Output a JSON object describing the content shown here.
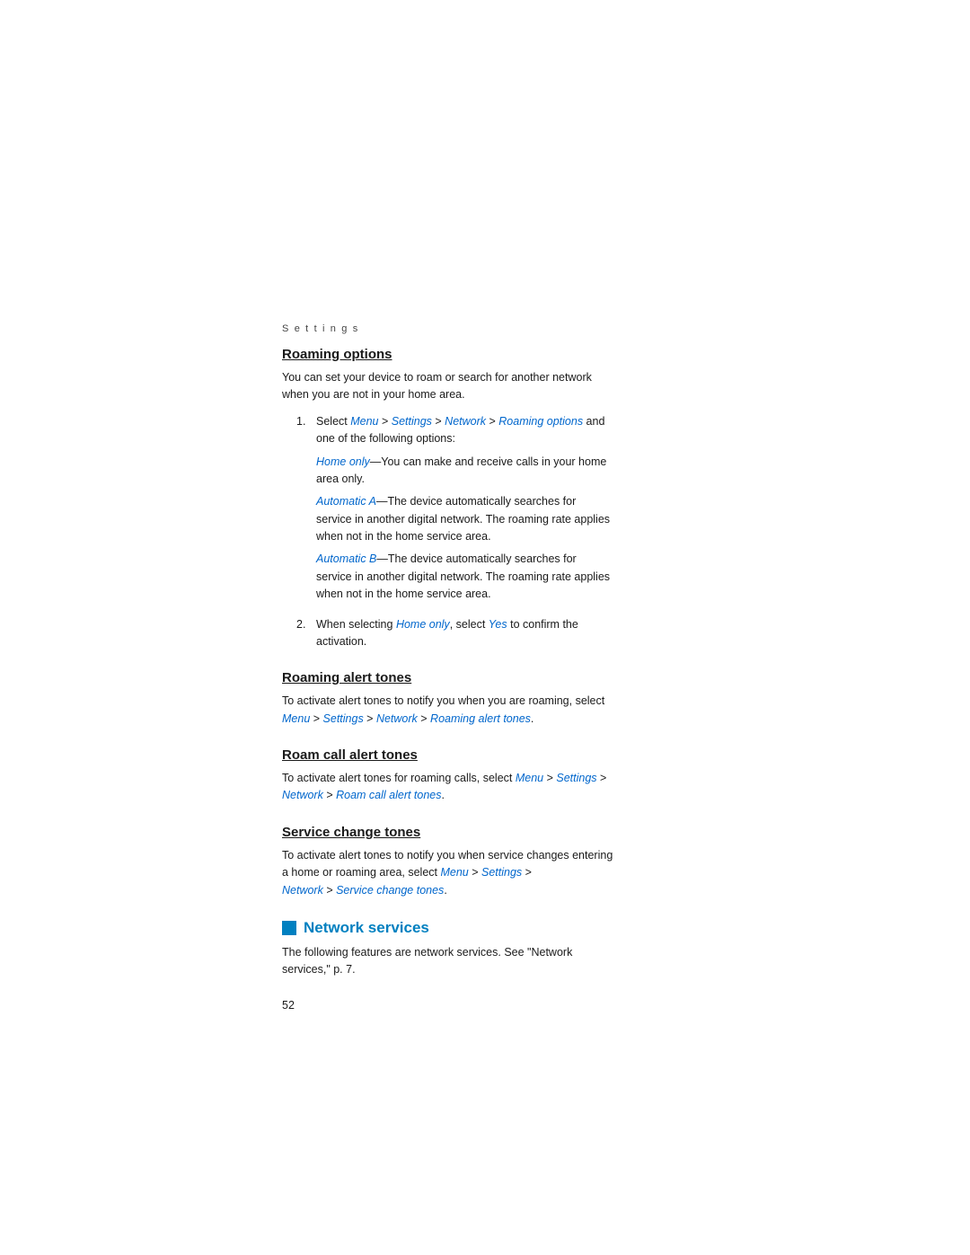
{
  "page": {
    "number": "52"
  },
  "breadcrumb": "S e t t i n g s",
  "sections": [
    {
      "id": "roaming-options",
      "title": "Roaming options",
      "style": "underline",
      "intro": "You can set your device to roam or search for another network when you are not in your home area.",
      "numbered_items": [
        {
          "num": "1.",
          "text_parts": [
            {
              "type": "text",
              "value": "Select "
            },
            {
              "type": "link",
              "value": "Menu"
            },
            {
              "type": "text",
              "value": " > "
            },
            {
              "type": "link",
              "value": "Settings"
            },
            {
              "type": "text",
              "value": " > "
            },
            {
              "type": "link",
              "value": "Network"
            },
            {
              "type": "text",
              "value": " > "
            },
            {
              "type": "link",
              "value": "Roaming options"
            },
            {
              "type": "text",
              "value": " and one of the following options:"
            }
          ],
          "options": [
            {
              "label": "Home only",
              "desc": "—You can make and receive calls in your home area only."
            },
            {
              "label": "Automatic A",
              "desc": "—The device automatically searches for service in another digital network. The roaming rate applies when not in the home service area."
            },
            {
              "label": "Automatic B",
              "desc": "—The device automatically searches for service in another digital network. The roaming rate applies when not in the home service area."
            }
          ]
        },
        {
          "num": "2.",
          "text_parts": [
            {
              "type": "text",
              "value": "When selecting "
            },
            {
              "type": "link",
              "value": "Home only"
            },
            {
              "type": "text",
              "value": ", select "
            },
            {
              "type": "link",
              "value": "Yes"
            },
            {
              "type": "text",
              "value": " to confirm the activation."
            }
          ],
          "options": []
        }
      ]
    },
    {
      "id": "roaming-alert-tones",
      "title": "Roaming alert tones",
      "style": "underline",
      "body": "To activate alert tones to notify you when you are roaming, select ",
      "body_links": [
        {
          "type": "link",
          "value": "Menu"
        },
        {
          "type": "text",
          "value": " > "
        },
        {
          "type": "link",
          "value": "Settings"
        },
        {
          "type": "text",
          "value": " > "
        },
        {
          "type": "link",
          "value": "Network"
        },
        {
          "type": "text",
          "value": " > "
        },
        {
          "type": "link",
          "value": "Roaming alert tones"
        },
        {
          "type": "text",
          "value": "."
        }
      ]
    },
    {
      "id": "roam-call-alert-tones",
      "title": "Roam call alert tones",
      "style": "underline",
      "body": "To activate alert tones for roaming calls, select ",
      "body_links": [
        {
          "type": "link",
          "value": "Menu"
        },
        {
          "type": "text",
          "value": " > "
        },
        {
          "type": "link",
          "value": "Settings"
        },
        {
          "type": "text",
          "value": " > "
        },
        {
          "type": "link",
          "value": "Network"
        },
        {
          "type": "text",
          "value": " > "
        },
        {
          "type": "link",
          "value": "Roam call alert tones"
        },
        {
          "type": "text",
          "value": "."
        }
      ]
    },
    {
      "id": "service-change-tones",
      "title": "Service change tones",
      "style": "underline",
      "body": "To activate alert tones to notify you when service changes entering a home or roaming area, select ",
      "body_links": [
        {
          "type": "link",
          "value": "Menu"
        },
        {
          "type": "text",
          "value": " > "
        },
        {
          "type": "link",
          "value": "Settings"
        },
        {
          "type": "text",
          "value": " > "
        },
        {
          "type": "link",
          "value": "Network"
        },
        {
          "type": "text",
          "value": " > "
        },
        {
          "type": "link",
          "value": "Service change tones"
        },
        {
          "type": "text",
          "value": "."
        }
      ]
    },
    {
      "id": "network-services",
      "title": "Network services",
      "style": "blue-heading",
      "body": "The following features are network services. See \"Network services,\" p. 7."
    }
  ]
}
